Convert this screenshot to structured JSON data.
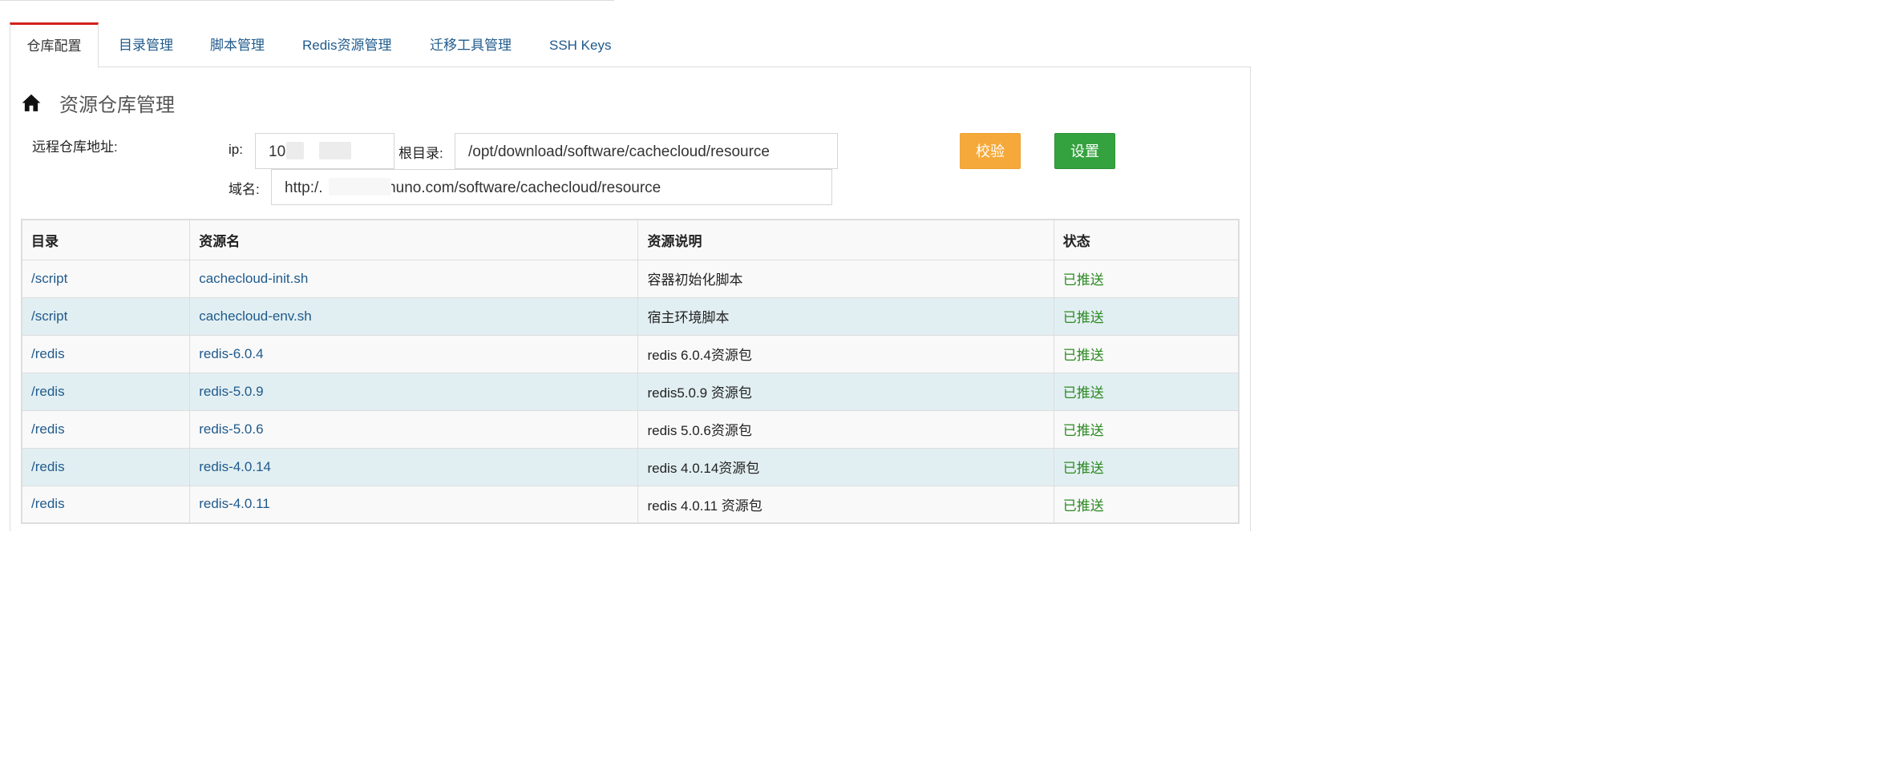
{
  "tabs": [
    "仓库配置",
    "目录管理",
    "脚本管理",
    "Redis资源管理",
    "迁移工具管理",
    "SSH Keys"
  ],
  "page": {
    "title": "资源仓库管理",
    "home_icon": "home-icon"
  },
  "form": {
    "remote_label": "远程仓库地址:",
    "ip_label": "ip:",
    "ip_value": "10",
    "root_label": "根目录:",
    "root_value": "/opt/download/software/cachecloud/resource",
    "domain_label": "域名:",
    "domain_prefix": "http:/.",
    "domain_suffix": "ohuno.com/software/cachecloud/resource",
    "verify_button": "校验",
    "set_button": "设置"
  },
  "table": {
    "headers": [
      "目录",
      "资源名",
      "资源说明",
      "状态"
    ],
    "rows": [
      {
        "dir": "/script",
        "name": "cachecloud-init.sh",
        "desc": "容器初始化脚本",
        "status": "已推送"
      },
      {
        "dir": "/script",
        "name": "cachecloud-env.sh",
        "desc": "宿主环境脚本",
        "status": "已推送"
      },
      {
        "dir": "/redis",
        "name": "redis-6.0.4",
        "desc": "redis 6.0.4资源包",
        "status": "已推送"
      },
      {
        "dir": "/redis",
        "name": "redis-5.0.9",
        "desc": "redis5.0.9 资源包",
        "status": "已推送"
      },
      {
        "dir": "/redis",
        "name": "redis-5.0.6",
        "desc": "redis 5.0.6资源包",
        "status": "已推送"
      },
      {
        "dir": "/redis",
        "name": "redis-4.0.14",
        "desc": "redis 4.0.14资源包",
        "status": "已推送"
      },
      {
        "dir": "/redis",
        "name": "redis-4.0.11",
        "desc": "redis 4.0.11 资源包",
        "status": "已推送"
      }
    ]
  },
  "colors": {
    "tab_active_accent": "#d1201a",
    "link": "#1f5a8c",
    "status_ok": "#2d8a23",
    "verify_btn": "#f5a93a",
    "set_btn": "#35a240",
    "row_alt": "#e2eff2"
  }
}
